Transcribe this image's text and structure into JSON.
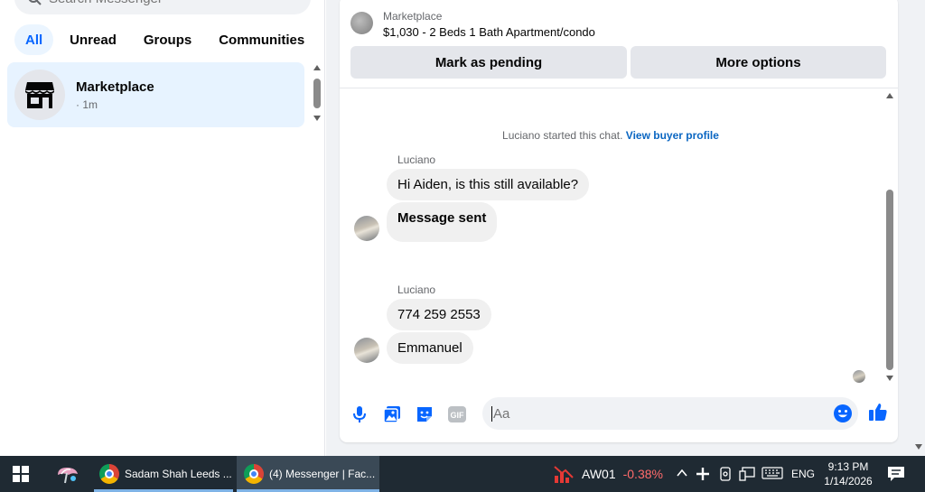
{
  "search": {
    "placeholder": "Search Messenger"
  },
  "filters": [
    {
      "label": "All",
      "active": true
    },
    {
      "label": "Unread",
      "active": false
    },
    {
      "label": "Groups",
      "active": false
    },
    {
      "label": "Communities",
      "active": false
    }
  ],
  "conversation": {
    "name": "Marketplace",
    "time": "· 1m",
    "icon": "storefront-icon"
  },
  "listing": {
    "label": "Marketplace",
    "title": "$1,030 - 2 Beds 1 Bath Apartment/condo",
    "pending_button": "Mark as pending",
    "more_button": "More options"
  },
  "chat": {
    "system_note": "Luciano started this chat.",
    "system_link": "View buyer profile",
    "groups": [
      {
        "sender": "Luciano",
        "messages": [
          "Hi Aiden, is this still available?",
          "Message sent"
        ]
      },
      {
        "sender": "Luciano",
        "messages": [
          "774 259 2553",
          "Emmanuel"
        ]
      }
    ]
  },
  "composer": {
    "placeholder": "Aa",
    "icons": [
      "microphone-icon",
      "photo-icon",
      "sticker-icon",
      "gif-icon",
      "emoji-icon",
      "thumbs-up-icon"
    ],
    "gif_label": "GIF"
  },
  "taskbar": {
    "apps": [
      {
        "label": "Sadam Shah Leeds ..."
      },
      {
        "label": "(4) Messenger | Fac..."
      }
    ],
    "stock": {
      "ticker": "AW01",
      "change": "-0.38%"
    },
    "language": "ENG",
    "time": "9:13 PM",
    "date": "1/14/2026"
  },
  "colors": {
    "accent": "#0866ff",
    "link": "#0a66c2",
    "like": "#0866ff",
    "bubble": "#f0f0f0",
    "taskbar": "#1f2a33",
    "stock_down": "#ff6b6b"
  }
}
